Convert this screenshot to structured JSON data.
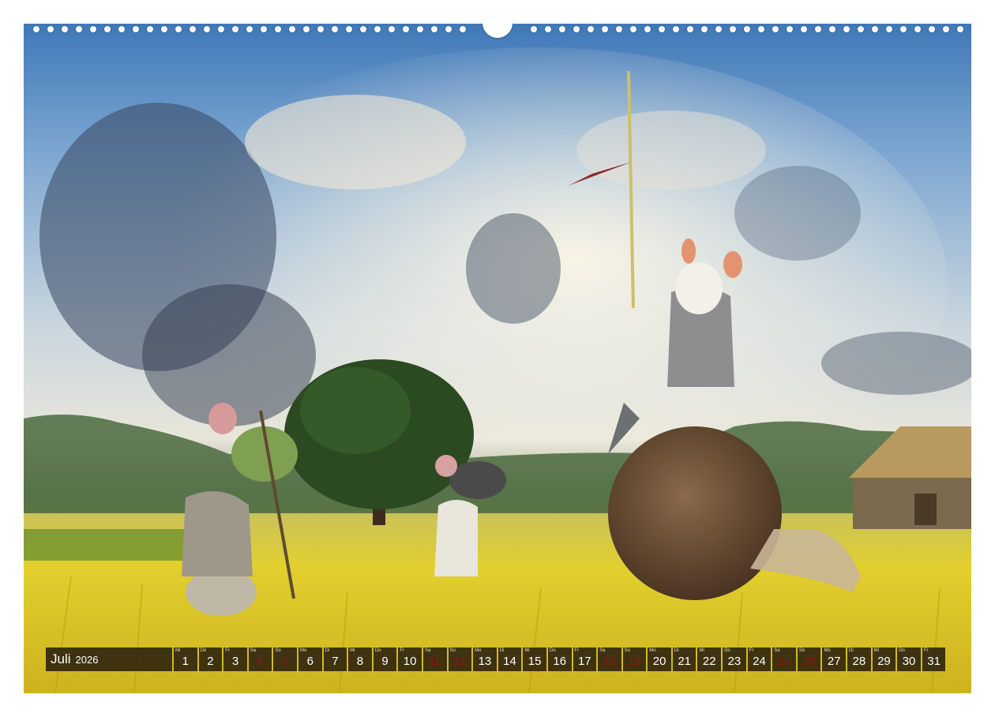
{
  "calendar": {
    "month": "Juli",
    "year": "2026",
    "days": [
      {
        "weekday": "Mi",
        "day": "1",
        "weekend": false
      },
      {
        "weekday": "Do",
        "day": "2",
        "weekend": false
      },
      {
        "weekday": "Fr",
        "day": "3",
        "weekend": false
      },
      {
        "weekday": "Sa",
        "day": "4",
        "weekend": true
      },
      {
        "weekday": "So",
        "day": "5",
        "weekend": true
      },
      {
        "weekday": "Mo",
        "day": "6",
        "weekend": false
      },
      {
        "weekday": "Di",
        "day": "7",
        "weekend": false
      },
      {
        "weekday": "Mi",
        "day": "8",
        "weekend": false
      },
      {
        "weekday": "Do",
        "day": "9",
        "weekend": false
      },
      {
        "weekday": "Fr",
        "day": "10",
        "weekend": false
      },
      {
        "weekday": "Sa",
        "day": "11",
        "weekend": true
      },
      {
        "weekday": "So",
        "day": "12",
        "weekend": true
      },
      {
        "weekday": "Mo",
        "day": "13",
        "weekend": false
      },
      {
        "weekday": "Di",
        "day": "14",
        "weekend": false
      },
      {
        "weekday": "Mi",
        "day": "15",
        "weekend": false
      },
      {
        "weekday": "Do",
        "day": "16",
        "weekend": false
      },
      {
        "weekday": "Fr",
        "day": "17",
        "weekend": false
      },
      {
        "weekday": "Sa",
        "day": "18",
        "weekend": true
      },
      {
        "weekday": "So",
        "day": "19",
        "weekend": true
      },
      {
        "weekday": "Mo",
        "day": "20",
        "weekend": false
      },
      {
        "weekday": "Di",
        "day": "21",
        "weekend": false
      },
      {
        "weekday": "Mi",
        "day": "22",
        "weekend": false
      },
      {
        "weekday": "Do",
        "day": "23",
        "weekend": false
      },
      {
        "weekday": "Fr",
        "day": "24",
        "weekend": false
      },
      {
        "weekday": "Sa",
        "day": "25",
        "weekend": true
      },
      {
        "weekday": "So",
        "day": "26",
        "weekend": true
      },
      {
        "weekday": "Mo",
        "day": "27",
        "weekend": false
      },
      {
        "weekday": "Di",
        "day": "28",
        "weekend": false
      },
      {
        "weekday": "Mi",
        "day": "29",
        "weekend": false
      },
      {
        "weekday": "Do",
        "day": "30",
        "weekend": false
      },
      {
        "weekday": "Fr",
        "day": "31",
        "weekend": false
      }
    ]
  },
  "colors": {
    "strip_background": "#2d240e",
    "weekday_number": "#ffffff",
    "weekend_number": "#8a1616",
    "page_background": "#ffffff"
  }
}
